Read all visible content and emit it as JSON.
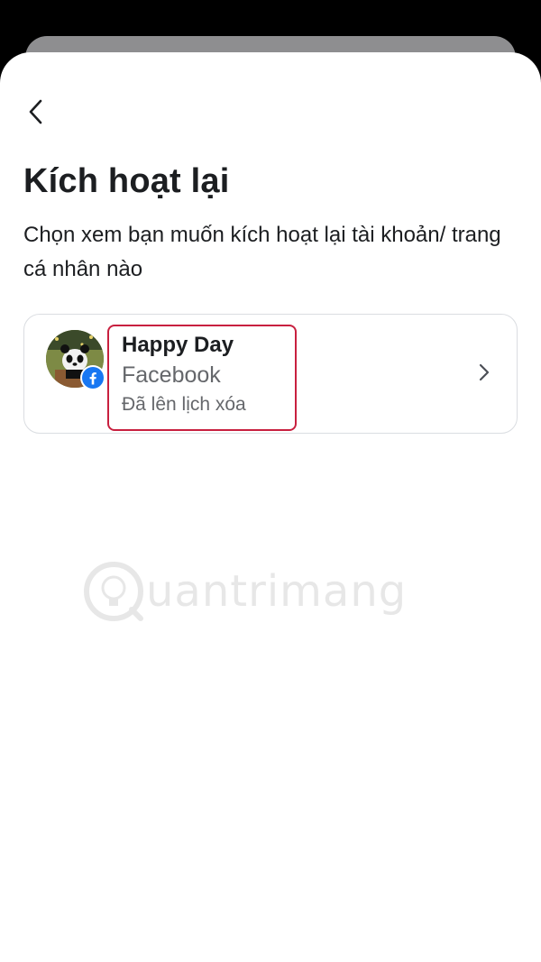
{
  "header": {
    "title": "Kích hoạt lại",
    "subtitle": "Chọn xem bạn muốn kích hoạt lại tài khoản/ trang cá nhân nào"
  },
  "account": {
    "name": "Happy Day",
    "platform": "Facebook",
    "status": "Đã lên lịch xóa",
    "avatar_icon": "panda-avatar",
    "badge_icon": "facebook-icon"
  },
  "watermark": {
    "text": "uantrimang"
  },
  "colors": {
    "highlight": "#c8203f",
    "facebook_blue": "#1877f2",
    "text_primary": "#1c1e21",
    "text_secondary": "#65676b"
  }
}
